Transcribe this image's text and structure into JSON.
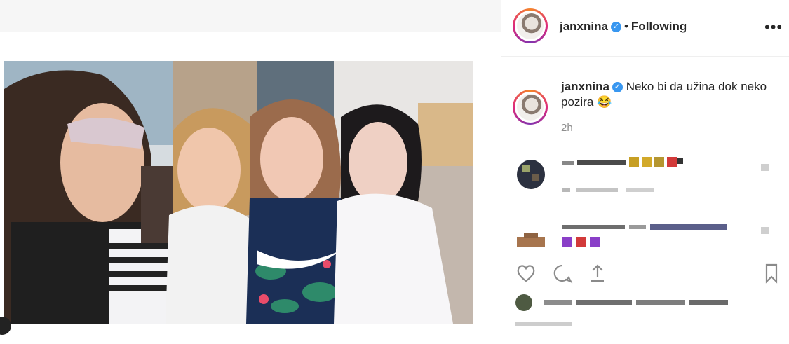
{
  "post": {
    "username": "janxnina",
    "verified_icon": "verified-badge-icon",
    "separator": "•",
    "follow_status": "Following",
    "more_icon": "more-options-icon",
    "caption_text": "Neko bi da užina dok neko pozira 😂",
    "timestamp": "2h"
  },
  "actions": {
    "like_icon": "heart-icon",
    "comment_icon": "comment-icon",
    "share_icon": "share-icon",
    "save_icon": "bookmark-icon"
  },
  "colors": {
    "verified": "#3897f0",
    "text": "#262626",
    "muted": "#8e8e8e",
    "divider": "#efefef"
  }
}
